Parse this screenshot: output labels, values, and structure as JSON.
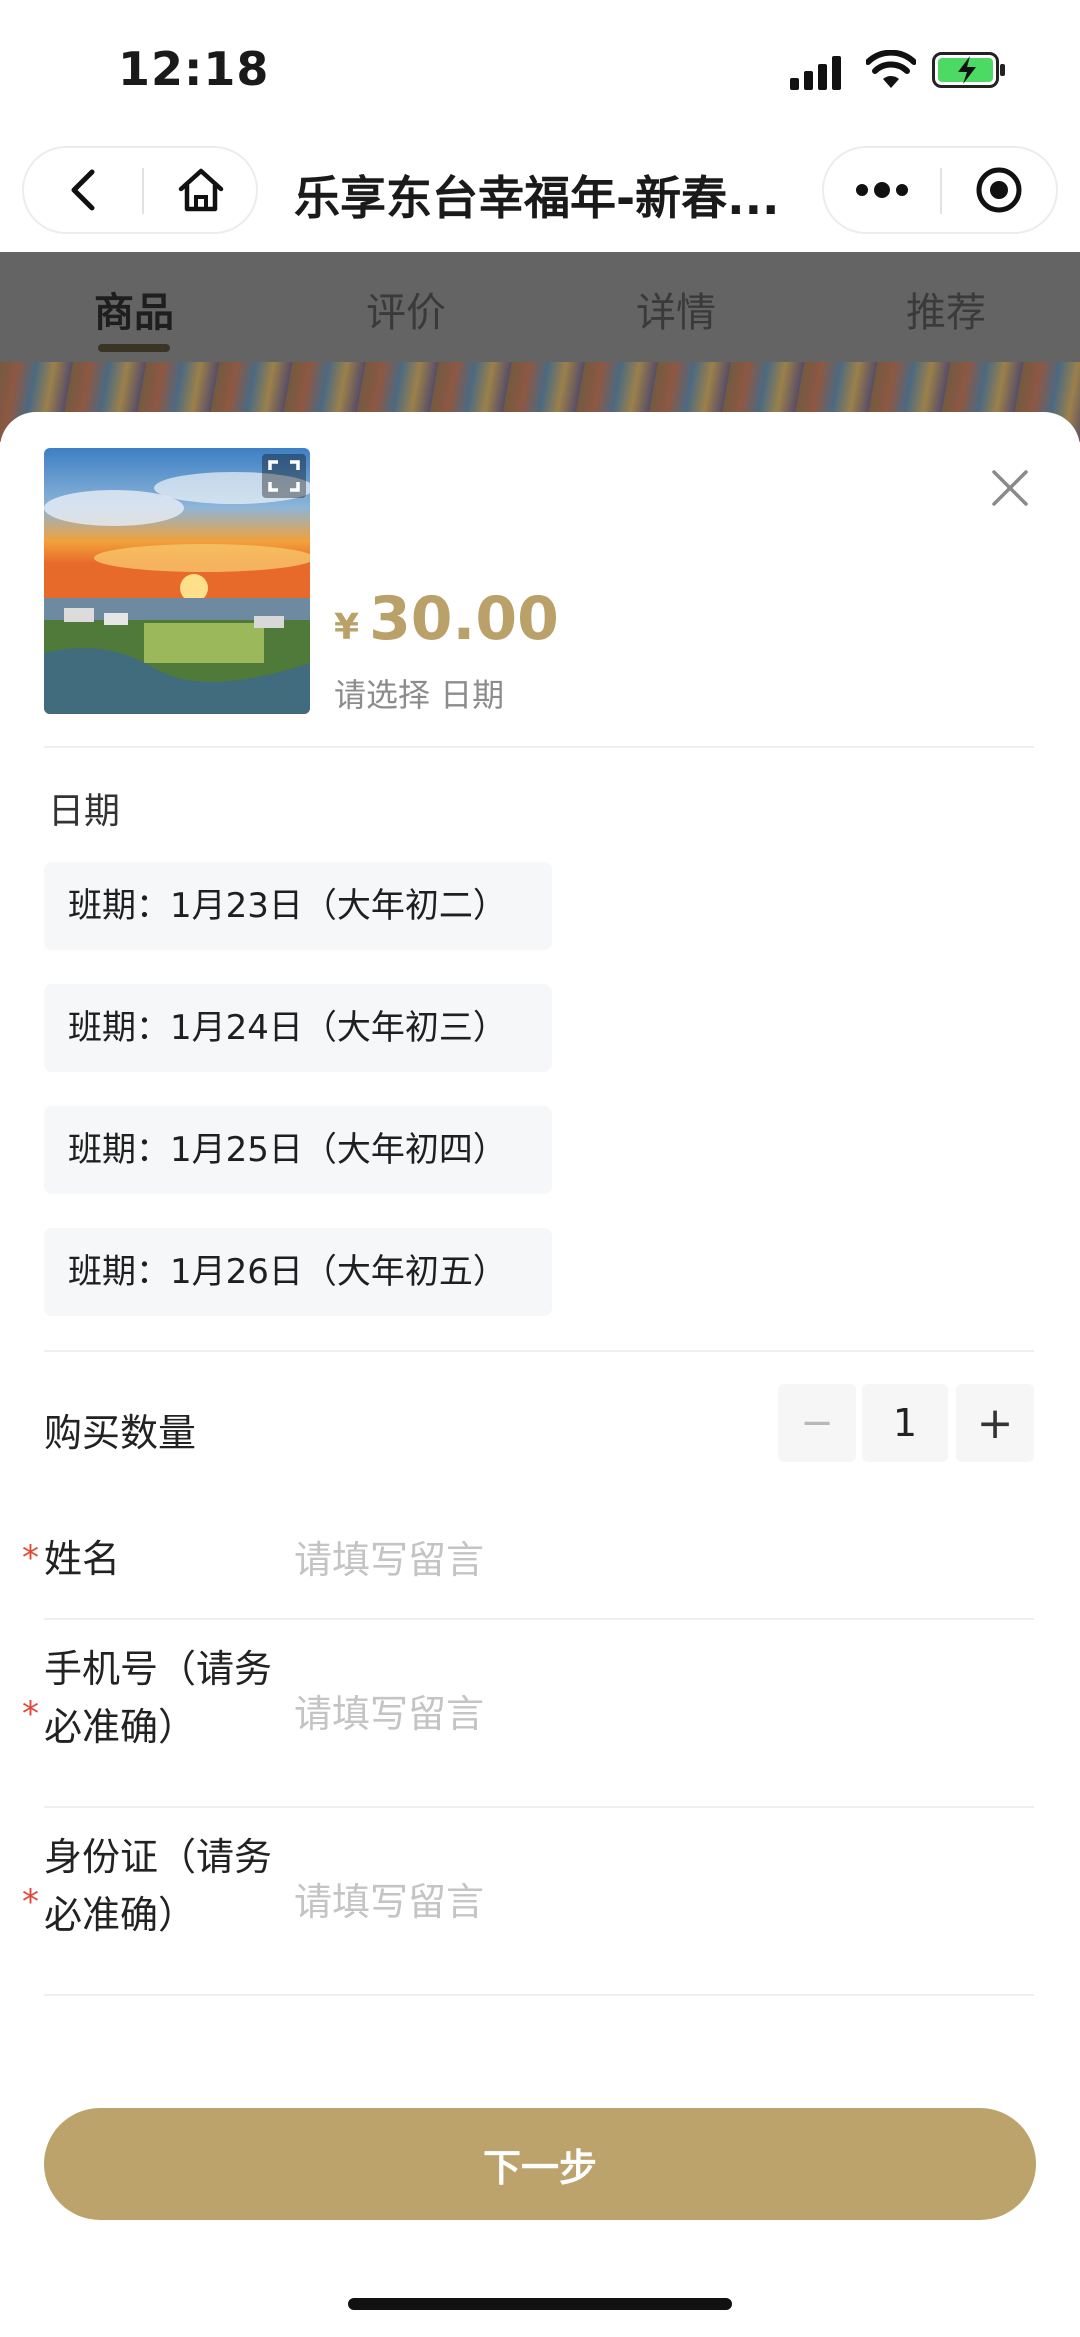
{
  "status_bar": {
    "time": "12:18"
  },
  "nav": {
    "title": "乐享东台幸福年-新春..."
  },
  "tabs": [
    {
      "label": "商品"
    },
    {
      "label": "评价"
    },
    {
      "label": "详情"
    },
    {
      "label": "推荐"
    }
  ],
  "product": {
    "currency": "¥",
    "price": "30.00",
    "hint": "请选择 日期"
  },
  "date_section": {
    "label": "日期",
    "options": [
      {
        "label": "班期：1月23日（大年初二）"
      },
      {
        "label": "班期：1月24日（大年初三）"
      },
      {
        "label": "班期：1月25日（大年初四）"
      },
      {
        "label": "班期：1月26日（大年初五）"
      }
    ]
  },
  "quantity": {
    "label": "购买数量",
    "minus": "−",
    "value": "1",
    "plus": "+"
  },
  "form": {
    "required_mark": "*",
    "fields": [
      {
        "label": "姓名",
        "placeholder": "请填写留言"
      },
      {
        "label": "手机号（请务必准确）",
        "placeholder": "请填写留言"
      },
      {
        "label": "身份证（请务必准确）",
        "placeholder": "请填写留言"
      }
    ]
  },
  "actions": {
    "next_label": "下一步"
  },
  "colors": {
    "accent": "#bca36c",
    "price": "#b9a169",
    "required": "#e0483a"
  }
}
